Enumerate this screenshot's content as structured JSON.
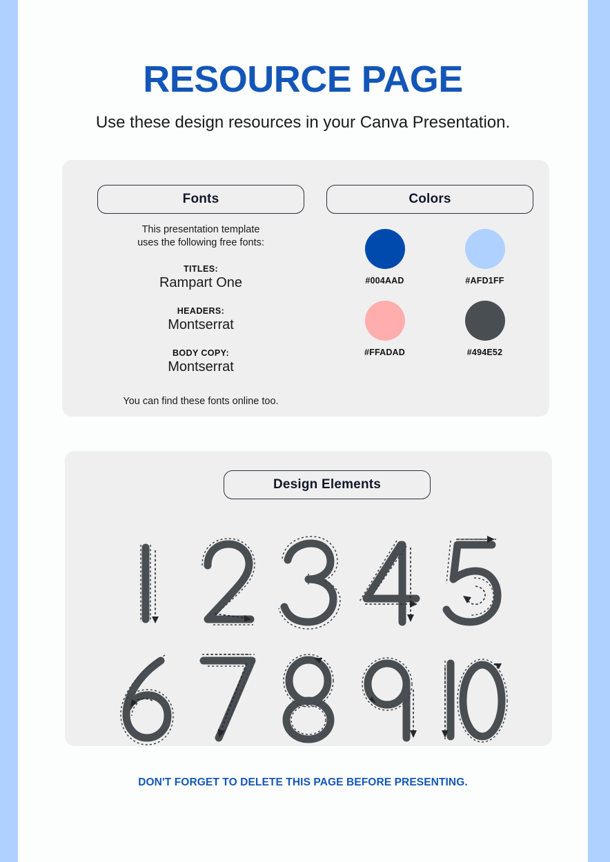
{
  "page": {
    "title": "RESOURCE PAGE",
    "subtitle": "Use these design resources in your Canva Presentation.",
    "title_color": "#1456B8",
    "side_band_color": "#AFD1FF",
    "card_background": "#EFEFEF",
    "page_background": "#FBFEFD",
    "footer_note": "DON'T FORGET TO DELETE THIS PAGE BEFORE PRESENTING."
  },
  "fonts_section": {
    "heading": "Fonts",
    "intro_line1": "This presentation template",
    "intro_line2": "uses the following free fonts:",
    "groups": [
      {
        "label": "TITLES:",
        "value": "Rampart One"
      },
      {
        "label": "HEADERS:",
        "value": "Montserrat"
      },
      {
        "label": "BODY COPY:",
        "value": "Montserrat"
      }
    ],
    "footnote": "You can find these fonts online too."
  },
  "colors_section": {
    "heading": "Colors",
    "swatches": [
      {
        "hex": "#004AAD",
        "label": "#004AAD"
      },
      {
        "hex": "#AFD1FF",
        "label": "#AFD1FF"
      },
      {
        "hex": "#FFADAD",
        "label": "#FFADAD"
      },
      {
        "hex": "#494E52",
        "label": "#494E52"
      }
    ]
  },
  "design_elements_section": {
    "heading": "Design Elements",
    "stroke_color": "#494E52",
    "rows": [
      [
        {
          "name": "number-1",
          "value": "1"
        },
        {
          "name": "number-2",
          "value": "2"
        },
        {
          "name": "number-3",
          "value": "3"
        },
        {
          "name": "number-4",
          "value": "4"
        },
        {
          "name": "number-5",
          "value": "5"
        }
      ],
      [
        {
          "name": "number-6",
          "value": "6"
        },
        {
          "name": "number-7",
          "value": "7"
        },
        {
          "name": "number-8",
          "value": "8"
        },
        {
          "name": "number-9",
          "value": "9"
        },
        {
          "name": "number-10",
          "value": "10"
        }
      ]
    ]
  }
}
